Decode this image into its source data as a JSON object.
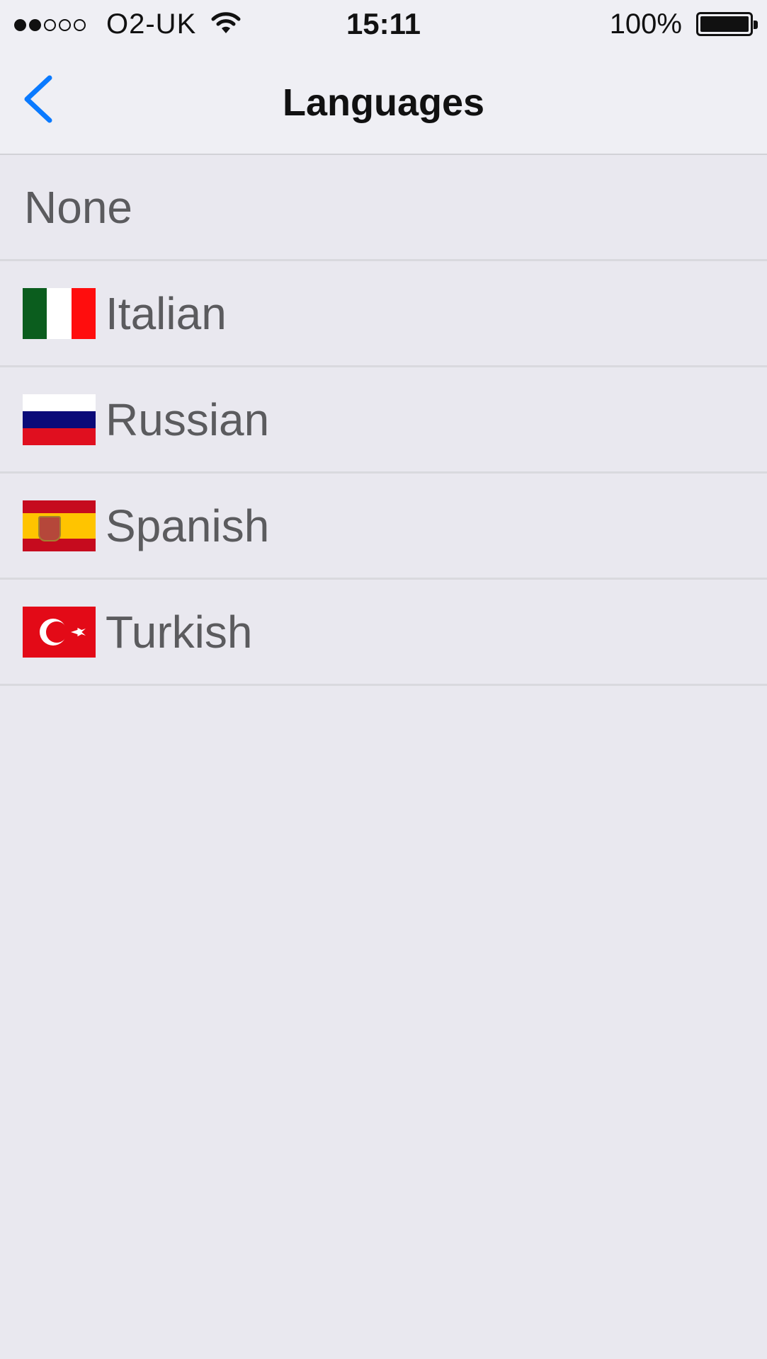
{
  "status_bar": {
    "signal_full": 2,
    "signal_total": 5,
    "carrier": "O2-UK",
    "time": "15:11",
    "battery_percent": "100%",
    "battery_level": 1.0
  },
  "nav": {
    "title": "Languages",
    "back_icon": "chevron-left-icon",
    "accent_color": "#0a7aff"
  },
  "languages": [
    {
      "label": "None",
      "flag": null
    },
    {
      "label": "Italian",
      "flag": "italy-flag-icon"
    },
    {
      "label": "Russian",
      "flag": "russia-flag-icon"
    },
    {
      "label": "Spanish",
      "flag": "spain-flag-icon"
    },
    {
      "label": "Turkish",
      "flag": "turkey-flag-icon"
    }
  ],
  "colors": {
    "background": "#e9e8ef",
    "bar_background": "#efeff4",
    "separator": "#d9d9de",
    "row_text": "#5b5b5e"
  }
}
